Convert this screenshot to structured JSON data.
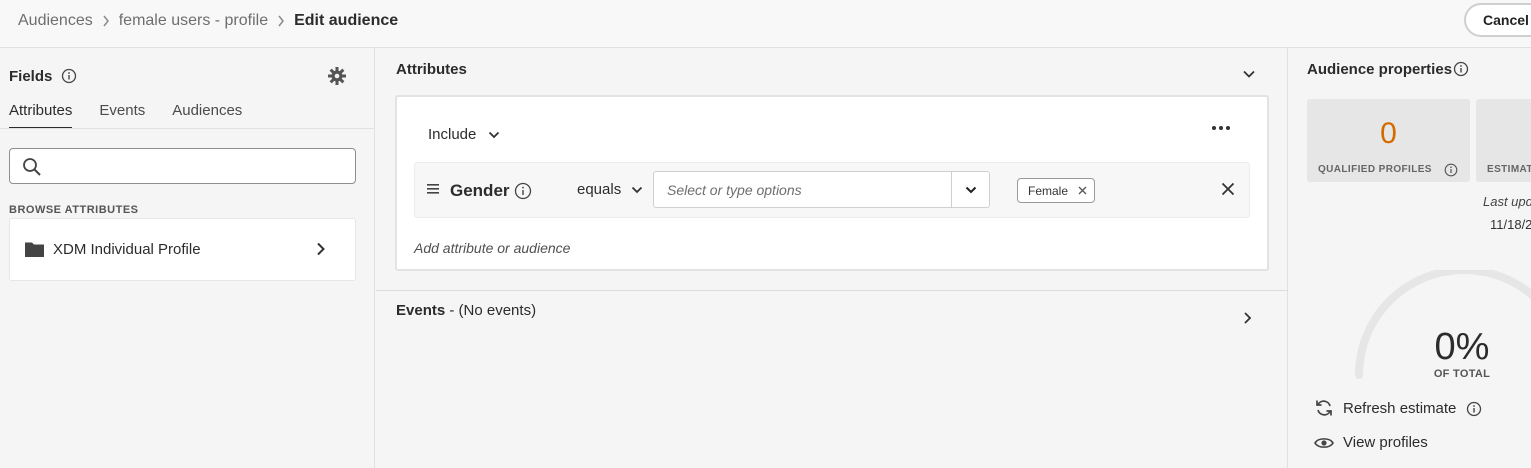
{
  "breadcrumb": {
    "items": [
      "Audiences",
      "female users - profile"
    ],
    "current": "Edit audience"
  },
  "header": {
    "cancel_label": "Cancel"
  },
  "fields_panel": {
    "title": "Fields",
    "tabs": [
      {
        "label": "Attributes",
        "active": true
      },
      {
        "label": "Events",
        "active": false
      },
      {
        "label": "Audiences",
        "active": false
      }
    ],
    "search_placeholder": "",
    "browse_heading": "BROWSE ATTRIBUTES",
    "browse_items": [
      {
        "label": "XDM Individual Profile",
        "icon": "folder-icon"
      }
    ]
  },
  "rule_builder": {
    "attributes_title": "Attributes",
    "include_label": "Include",
    "condition": {
      "attribute": "Gender",
      "operator": "equals",
      "value_placeholder": "Select or type options",
      "selected_values": [
        "Female"
      ]
    },
    "add_label": "Add attribute or audience",
    "events_title": "Events",
    "events_note": " - (No events)"
  },
  "properties": {
    "title": "Audience properties",
    "qualified_value": "0",
    "qualified_label": "QUALIFIED PROFILES",
    "estimated_label": "ESTIMATED",
    "last_updated_label": "Last updated",
    "last_updated_value": "11/18/2",
    "percent": "0%",
    "percent_value": 0,
    "percent_label": "OF TOTAL",
    "refresh_label": "Refresh estimate",
    "view_label": "View profiles",
    "accent_color": "#d46a00"
  }
}
